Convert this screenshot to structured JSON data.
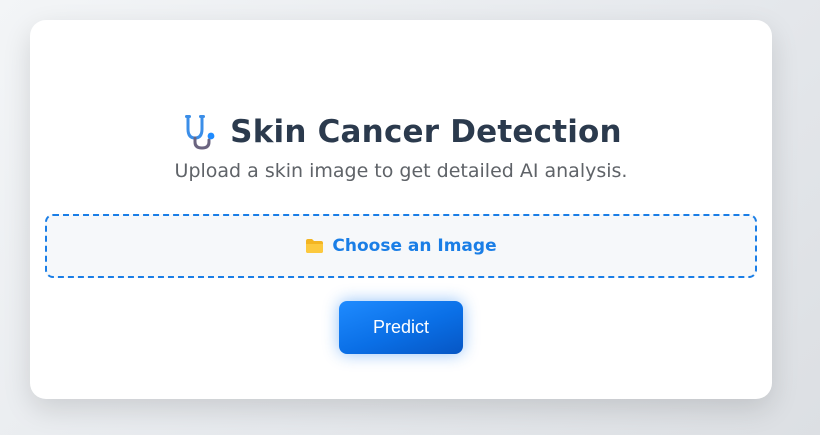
{
  "app": {
    "title": "Skin Cancer Detection",
    "subtitle": "Upload a skin image to get detailed AI analysis.",
    "title_icon": "stethoscope-icon"
  },
  "upload": {
    "label": "Choose an Image",
    "icon": "folder-icon"
  },
  "actions": {
    "predict_label": "Predict"
  },
  "colors": {
    "accent": "#1a7ee6",
    "title_text": "#2b3a4d",
    "subtitle_text": "#5f6368",
    "button_gradient_start": "#1f8bff",
    "button_gradient_end": "#0656c4",
    "folder_yellow": "#f8c133"
  }
}
